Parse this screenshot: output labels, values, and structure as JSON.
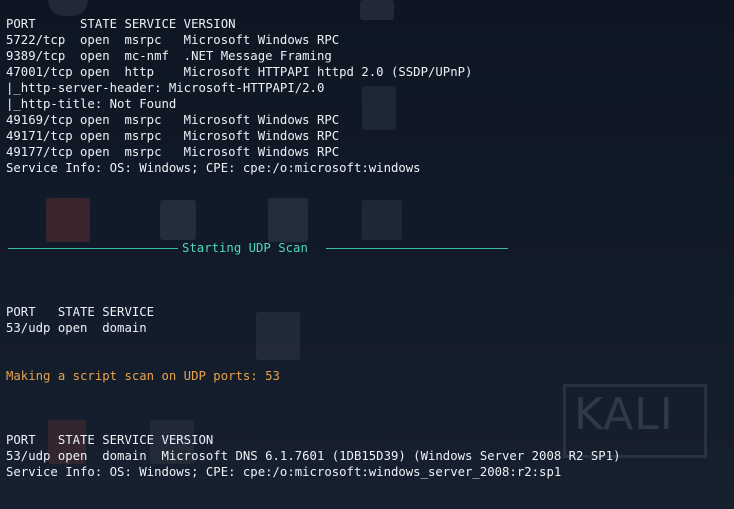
{
  "terminal": {
    "tcp_block": [
      "PORT      STATE SERVICE VERSION",
      "5722/tcp  open  msrpc   Microsoft Windows RPC",
      "9389/tcp  open  mc-nmf  .NET Message Framing",
      "47001/tcp open  http    Microsoft HTTPAPI httpd 2.0 (SSDP/UPnP)",
      "|_http-server-header: Microsoft-HTTPAPI/2.0",
      "|_http-title: Not Found",
      "49169/tcp open  msrpc   Microsoft Windows RPC",
      "49171/tcp open  msrpc   Microsoft Windows RPC",
      "49177/tcp open  msrpc   Microsoft Windows RPC",
      "Service Info: OS: Windows; CPE: cpe:/o:microsoft:windows"
    ],
    "udp_separator_label": "Starting UDP Scan",
    "udp_ports_block": [
      "PORT   STATE SERVICE",
      "53/udp open  domain"
    ],
    "udp_script_message": "Making a script scan on UDP ports: 53",
    "udp_version_block": [
      "PORT   STATE SERVICE VERSION",
      "53/udp open  domain  Microsoft DNS 6.1.7601 (1DB15D39) (Windows Server 2008 R2 SP1)",
      "Service Info: OS: Windows; CPE: cpe:/o:microsoft:windows_server_2008:r2:sp1"
    ]
  },
  "colors": {
    "background": "#0f1726",
    "text": "#eef1f5",
    "separator": "#38bfa5",
    "separator_text": "#4fd8bc",
    "highlight": "#e8a24a"
  },
  "watermark": {
    "logo_text": "KALI",
    "logo_icon": "kali-logo-icon"
  }
}
